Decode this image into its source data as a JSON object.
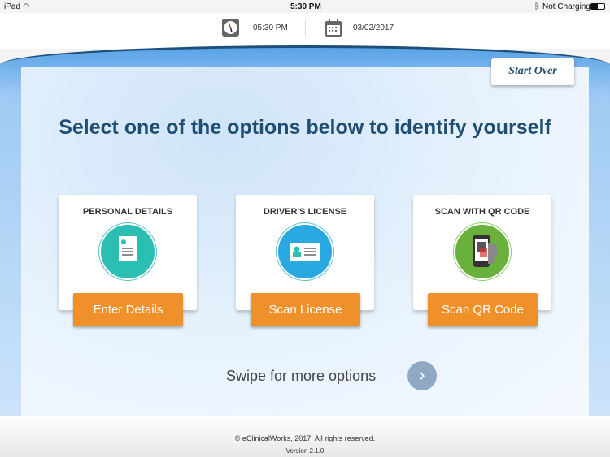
{
  "status_bar": {
    "device": "iPad",
    "time": "5:30 PM",
    "battery_status": "Not Charging"
  },
  "header": {
    "time": "05:30 PM",
    "date": "03/02/2017"
  },
  "start_over": "Start Over",
  "title": "Select one of the options below to identify yourself",
  "options": [
    {
      "label": "PERSONAL DETAILS",
      "button": "Enter Details",
      "icon": "id-document-icon",
      "color": "#2bbfb3"
    },
    {
      "label": "DRIVER'S LICENSE",
      "button": "Scan License",
      "icon": "id-card-icon",
      "color": "#2aa9e0"
    },
    {
      "label": "SCAN WITH QR CODE",
      "button": "Scan QR Code",
      "icon": "qr-scan-icon",
      "color": "#6ab03c"
    }
  ],
  "swipe_text": "Swipe for more options",
  "footer": {
    "copyright": "© eClinicalWorks, 2017. All rights reserved.",
    "version": "Version 2.1.0"
  }
}
